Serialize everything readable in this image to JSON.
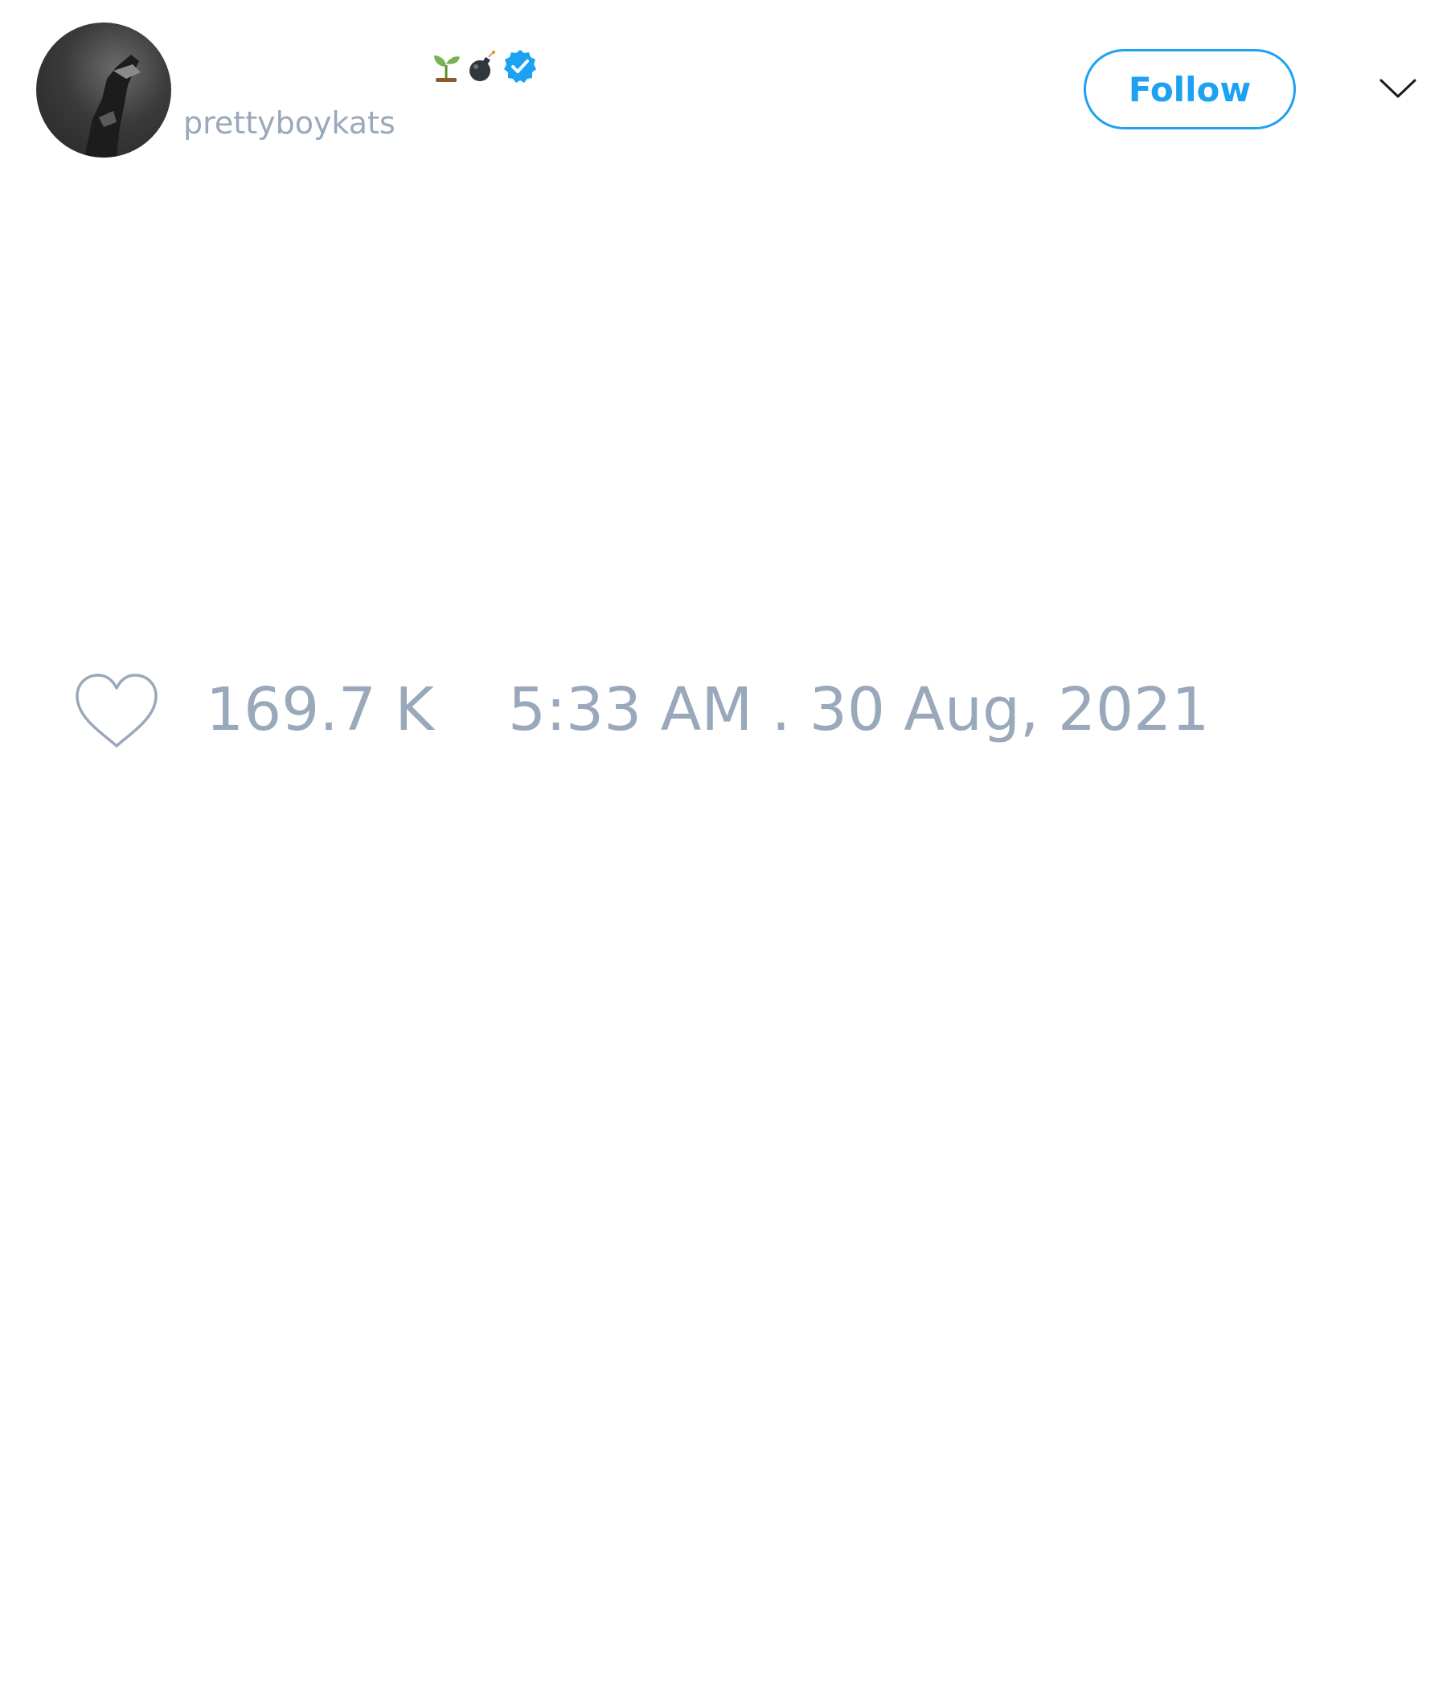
{
  "header": {
    "handle": "prettyboykats",
    "display_name_emojis": [
      "seedling-emoji",
      "bomb-emoji"
    ],
    "verified": true,
    "follow_label": "Follow",
    "more_icon": "chevron-down-icon"
  },
  "tweet": {
    "like_icon": "heart-icon",
    "like_count": "169.7 K",
    "timestamp": "5:33 AM . 30 Aug, 2021"
  },
  "colors": {
    "accent": "#1da1f2",
    "muted_text": "#9aa8bb",
    "background": "#ffffff"
  }
}
